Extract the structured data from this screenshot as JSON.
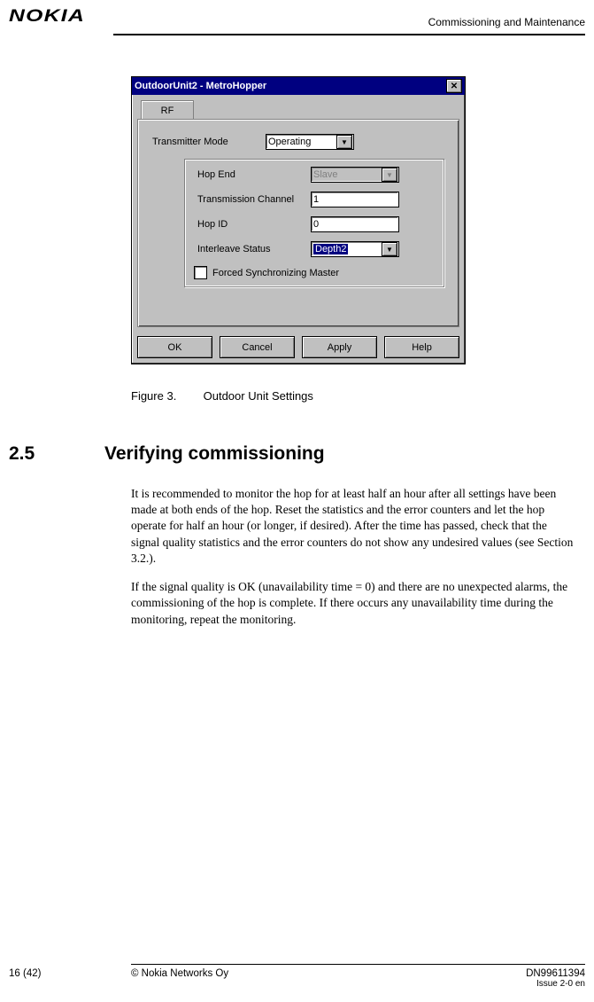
{
  "header": {
    "brand": "NOKIA",
    "section": "Commissioning and Maintenance"
  },
  "dialog": {
    "title": "OutdoorUnit2 - MetroHopper",
    "tab": "RF",
    "transmitter_mode_label": "Transmitter Mode",
    "transmitter_mode_value": "Operating",
    "hop_end_label": "Hop End",
    "hop_end_value": "Slave",
    "transmission_channel_label": "Transmission Channel",
    "transmission_channel_value": "1",
    "hop_id_label": "Hop ID",
    "hop_id_value": "0",
    "interleave_label": "Interleave Status",
    "interleave_value": "Depth2",
    "forced_sync_label": "Forced Synchronizing Master",
    "btn_ok": "OK",
    "btn_cancel": "Cancel",
    "btn_apply": "Apply",
    "btn_help": "Help"
  },
  "figure": {
    "num": "Figure 3.",
    "caption": "Outdoor Unit Settings"
  },
  "section": {
    "number": "2.5",
    "title": "Verifying commissioning",
    "para1": "It is recommended to monitor the hop for at least half an hour after all settings have been made at both ends of the hop. Reset the statistics and the error counters and let the hop operate for half an hour (or longer, if desired). After the time has passed, check that the signal quality statistics and the error counters do not show any undesired values (see Section 3.2.).",
    "para2": "If the signal quality is OK (unavailability time = 0) and there are no unexpected alarms, the commissioning of the hop is complete. If there occurs any unavailability time during the monitoring, repeat the monitoring."
  },
  "footer": {
    "page": "16 (42)",
    "copyright": "© Nokia Networks Oy",
    "docnum": "DN99611394",
    "issue": "Issue 2-0 en"
  }
}
